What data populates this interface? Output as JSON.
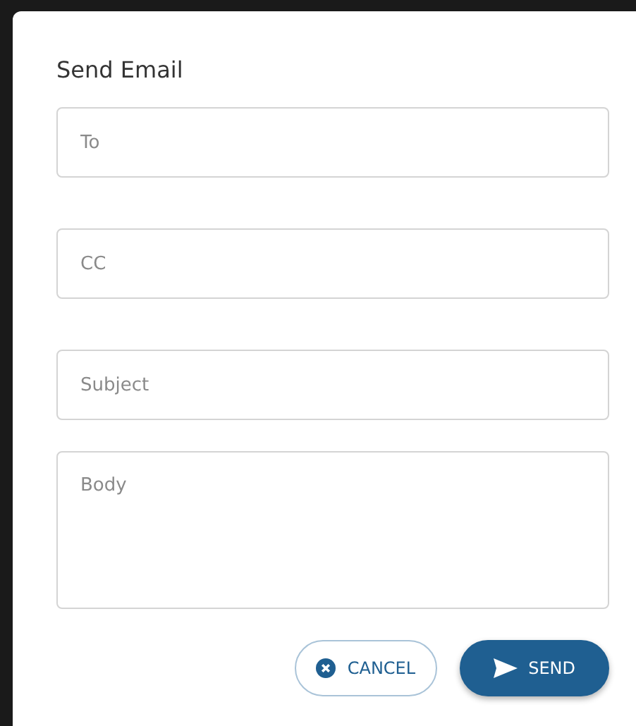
{
  "dialog": {
    "title": "Send Email"
  },
  "fields": [
    {
      "kind": "line",
      "placeholder": "To"
    },
    {
      "kind": "line",
      "placeholder": "CC"
    },
    {
      "kind": "line",
      "placeholder": "Subject"
    },
    {
      "kind": "area",
      "placeholder": "Body"
    }
  ],
  "buttons": [
    {
      "kind": "outline",
      "label": "CANCEL"
    },
    {
      "kind": "filled",
      "label": "SEND"
    }
  ]
}
